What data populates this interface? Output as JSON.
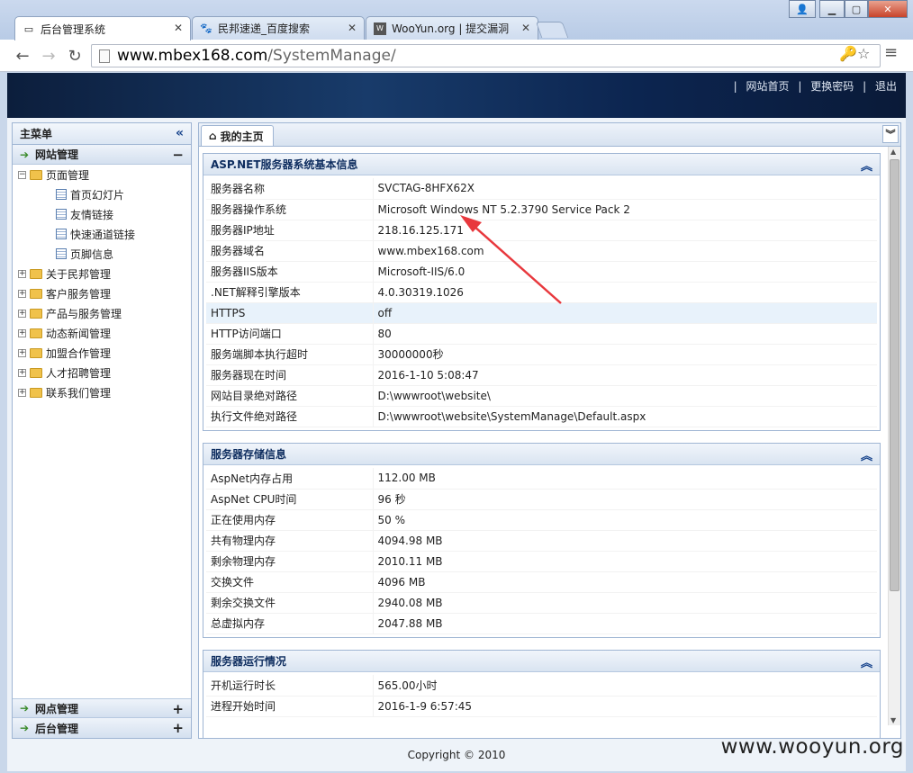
{
  "browser": {
    "tabs": [
      {
        "title": "后台管理系统",
        "icon": "page-icon",
        "active": true
      },
      {
        "title": "民邦速递_百度搜索",
        "icon": "baidu-paw-icon",
        "active": false
      },
      {
        "title": "WooYun.org | 提交漏洞",
        "icon": "wooyun-icon",
        "active": false
      }
    ],
    "address_host": "www.mbex168.com",
    "address_path": "/SystemManage/"
  },
  "header": {
    "links": [
      "网站首页",
      "更换密码",
      "退出"
    ],
    "separator": "|"
  },
  "sidebar": {
    "title": "主菜单",
    "sections": [
      {
        "label": "网站管理",
        "expanded": true
      },
      {
        "label": "网点管理",
        "expanded": false
      },
      {
        "label": "后台管理",
        "expanded": false
      }
    ],
    "tree": {
      "root": "页面管理",
      "children": [
        "首页幻灯片",
        "友情链接",
        "快速通道链接",
        "页脚信息"
      ],
      "siblings": [
        "关于民邦管理",
        "客户服务管理",
        "产品与服务管理",
        "动态新闻管理",
        "加盟合作管理",
        "人才招聘管理",
        "联系我们管理"
      ]
    }
  },
  "content": {
    "tab_label": "我的主页",
    "panels": [
      {
        "title": "ASP.NET服务器系统基本信息",
        "rows": [
          [
            "服务器名称",
            "SVCTAG-8HFX62X"
          ],
          [
            "服务器操作系统",
            "Microsoft Windows NT 5.2.3790 Service Pack 2"
          ],
          [
            "服务器IP地址",
            "218.16.125.171"
          ],
          [
            "服务器域名",
            "www.mbex168.com"
          ],
          [
            "服务器IIS版本",
            "Microsoft-IIS/6.0"
          ],
          [
            ".NET解释引擎版本",
            "4.0.30319.1026"
          ],
          [
            "HTTPS",
            "off"
          ],
          [
            "HTTP访问端口",
            "80"
          ],
          [
            "服务端脚本执行超时",
            "30000000秒"
          ],
          [
            "服务器现在时间",
            "2016-1-10 5:08:47"
          ],
          [
            "网站目录绝对路径",
            "D:\\wwwroot\\website\\"
          ],
          [
            "执行文件绝对路径",
            "D:\\wwwroot\\website\\SystemManage\\Default.aspx"
          ]
        ]
      },
      {
        "title": "服务器存储信息",
        "rows": [
          [
            "AspNet内存占用",
            "112.00 MB"
          ],
          [
            "AspNet CPU时间",
            "96 秒"
          ],
          [
            "正在使用内存",
            "50 %"
          ],
          [
            "共有物理内存",
            "4094.98 MB"
          ],
          [
            "剩余物理内存",
            "2010.11 MB"
          ],
          [
            "交换文件",
            "4096 MB"
          ],
          [
            "剩余交换文件",
            "2940.08 MB"
          ],
          [
            "总虚拟内存",
            "2047.88 MB"
          ]
        ]
      },
      {
        "title": "服务器运行情况",
        "rows": [
          [
            "开机运行时长",
            "565.00小时"
          ],
          [
            "进程开始时间",
            "2016-1-9 6:57:45"
          ]
        ]
      }
    ]
  },
  "footer": {
    "copyright": "Copyright © 2010"
  },
  "watermark": "www.wooyun.org",
  "colors": {
    "annotation_arrow": "#e8383d",
    "header_bg": "#12305c"
  }
}
